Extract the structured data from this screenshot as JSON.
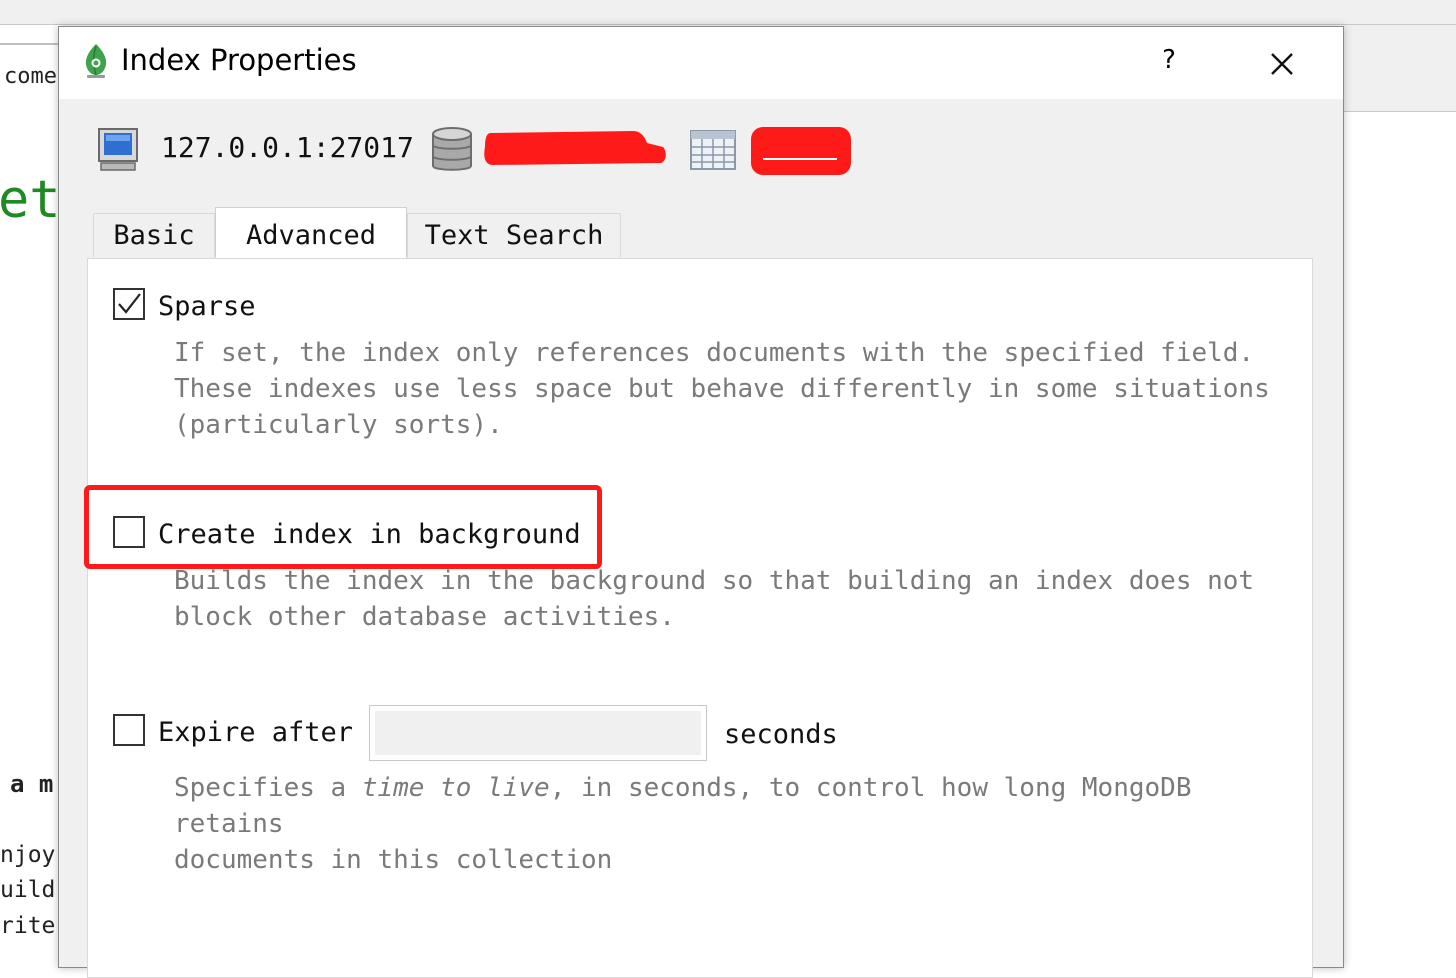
{
  "background": {
    "text_come": "come",
    "text_et": "et",
    "text_am": "a m",
    "text_njoy": "njoy",
    "text_uild": "uild",
    "text_rite": "rite"
  },
  "dialog": {
    "title": "Index Properties",
    "help_label": "?",
    "connection": {
      "host": "127.0.0.1:27017"
    },
    "colors": {
      "redaction": "#ff1a1a",
      "highlight_border": "#ff1a1a",
      "app_icon": "#3fa34d"
    },
    "tabs": [
      {
        "label": "Basic",
        "active": false
      },
      {
        "label": "Advanced",
        "active": true
      },
      {
        "label": "Text Search",
        "active": false
      }
    ],
    "options": {
      "sparse": {
        "label": "Sparse",
        "checked": true,
        "description": "If set, the index only references documents with the specified field.\nThese indexes use less space but behave differently in some situations\n(particularly sorts)."
      },
      "background": {
        "label": "Create index in background",
        "checked": false,
        "description": "Builds the index in the background so that building an index does not\nblock other database activities."
      },
      "expire": {
        "label": "Expire after",
        "checked": false,
        "value": "",
        "unit_label": "seconds",
        "description_pre": "Specifies a ",
        "description_em": "time to live",
        "description_post": ", in seconds, to control how long MongoDB retains\ndocuments in this collection"
      }
    }
  }
}
